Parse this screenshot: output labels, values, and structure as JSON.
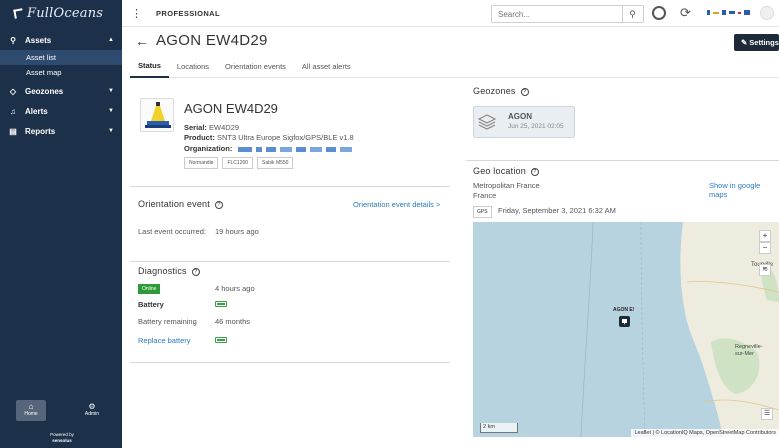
{
  "sidebar": {
    "logo": "FullOceans",
    "nav": {
      "assets": "Assets",
      "asset_list": "Asset list",
      "asset_map": "Asset map",
      "geozones": "Geozones",
      "alerts": "Alerts",
      "reports": "Reports"
    },
    "footer": {
      "home": "Home",
      "admin": "Admin",
      "powered_by": "Powered by",
      "powered_brand": "sensolus"
    }
  },
  "header": {
    "org_name": "PROFESSIONAL",
    "search_placeholder": "Search...",
    "icons": [
      "more-vert-icon",
      "help-lifebuoy-icon",
      "refresh-icon",
      "partner-logo",
      "avatar"
    ]
  },
  "page": {
    "title": "AGON EW4D29",
    "settings_label": "Settings",
    "tabs": [
      "Status",
      "Locations",
      "Orientation events",
      "All asset alerts"
    ]
  },
  "asset": {
    "name": "AGON EW4D29",
    "serial_label": "Serial:",
    "serial_value": "EW4D29",
    "product_label": "Product:",
    "product_value": "SNT3 Ultra Europe Sigfox/GPS/BLE v1.8",
    "organization_label": "Organization:",
    "tags": [
      "Normandie",
      "FLC1200",
      "Sabik M550"
    ]
  },
  "orientation": {
    "title": "Orientation event",
    "details_link": "Orientation event details >",
    "last_event_label": "Last event occurred:",
    "last_event_value": "19 hours ago"
  },
  "diagnostics": {
    "title": "Diagnostics",
    "status_badge": "Online",
    "last_seen": "4 hours ago",
    "battery_label": "Battery",
    "battery_remaining_label": "Battery remaining",
    "battery_remaining_value": "46 months",
    "replace_battery_link": "Replace battery"
  },
  "geozones": {
    "title": "Geozones",
    "zone_name": "AGON",
    "zone_date": "Jun 25, 2021 02:05"
  },
  "geo_location": {
    "title": "Geo location",
    "line1": "Metropolitan France",
    "line2": "France",
    "google_maps_link": "Show in google maps",
    "gps_badge": "GPS",
    "timestamp": "Friday, September 3, 2021 6:32 AM"
  },
  "map": {
    "marker_label": "AGON E!",
    "place_label_1": "Tourville",
    "place_label_2": "Regneville-sur-Mer",
    "scale_label": "2 km",
    "attribution": "Leaflet | © LocationIQ Maps, OpenStreetMap Contributors",
    "zoom_in": "+",
    "zoom_out": "−",
    "colors": {
      "sea": "#b7d3df",
      "land": "#eeecdf",
      "green": "#cfe3c4"
    }
  }
}
